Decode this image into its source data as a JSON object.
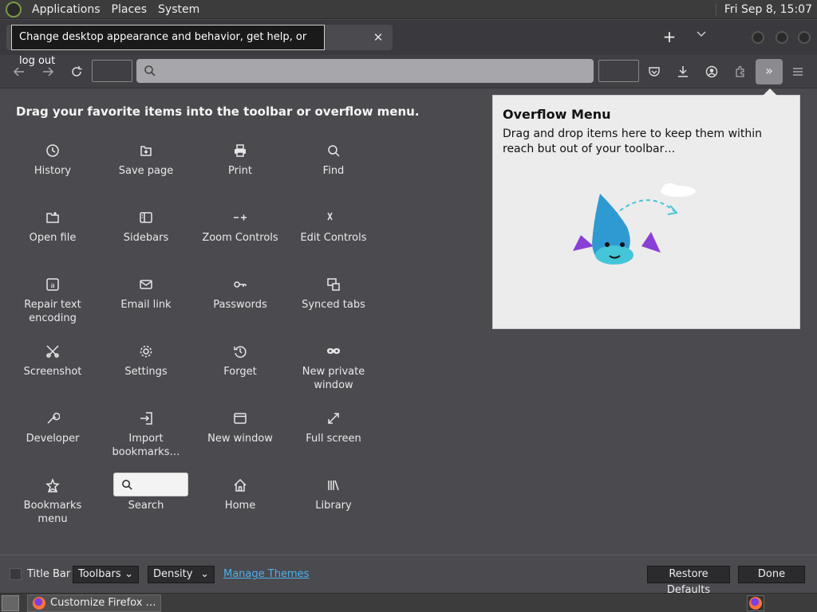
{
  "panel": {
    "menus": [
      "Applications",
      "Places",
      "System"
    ],
    "clock": "Fri Sep  8, 15:07"
  },
  "tooltip": "Change desktop appearance and behavior, get help, or log out",
  "palette": {
    "title": "Drag your favorite items into the toolbar or overflow menu.",
    "items": [
      {
        "label": "History",
        "icon": "clock-icon"
      },
      {
        "label": "Save page",
        "icon": "save-icon"
      },
      {
        "label": "Print",
        "icon": "printer-icon"
      },
      {
        "label": "Find",
        "icon": "magnifier-icon"
      },
      {
        "label": "Open file",
        "icon": "folder-open-icon"
      },
      {
        "label": "Sidebars",
        "icon": "sidebar-icon"
      },
      {
        "label": "Zoom Controls",
        "icon": "zoom-icon"
      },
      {
        "label": "Edit Controls",
        "icon": "edit-icon"
      },
      {
        "label": "Repair text encoding",
        "icon": "encoding-icon"
      },
      {
        "label": "Email link",
        "icon": "mail-icon"
      },
      {
        "label": "Passwords",
        "icon": "key-icon"
      },
      {
        "label": "Synced tabs",
        "icon": "synced-tabs-icon"
      },
      {
        "label": "Screenshot",
        "icon": "screenshot-icon"
      },
      {
        "label": "Settings",
        "icon": "gear-icon"
      },
      {
        "label": "Forget",
        "icon": "forget-icon"
      },
      {
        "label": "New private window",
        "icon": "mask-icon"
      },
      {
        "label": "Developer",
        "icon": "wrench-icon"
      },
      {
        "label": "Import bookmarks…",
        "icon": "import-icon"
      },
      {
        "label": "New window",
        "icon": "window-icon"
      },
      {
        "label": "Full screen",
        "icon": "fullscreen-icon"
      },
      {
        "label": "Bookmarks menu",
        "icon": "star-icon"
      },
      {
        "label": "Search",
        "icon": "search-icon"
      },
      {
        "label": "Home",
        "icon": "home-icon"
      },
      {
        "label": "Library",
        "icon": "library-icon"
      }
    ]
  },
  "overflow": {
    "title": "Overflow Menu",
    "description": "Drag and drop items here to keep them within reach but out of your toolbar…"
  },
  "footer": {
    "title_bar": "Title Bar",
    "toolbars": "Toolbars",
    "density": "Density",
    "manage_themes": "Manage Themes",
    "restore_defaults": "Restore Defaults",
    "done": "Done"
  },
  "taskbar": {
    "window_title": "Customize Firefox …"
  },
  "colors": {
    "background": "#4a4a4f",
    "link": "#4fb0e8",
    "panel_bg": "#ececec"
  }
}
